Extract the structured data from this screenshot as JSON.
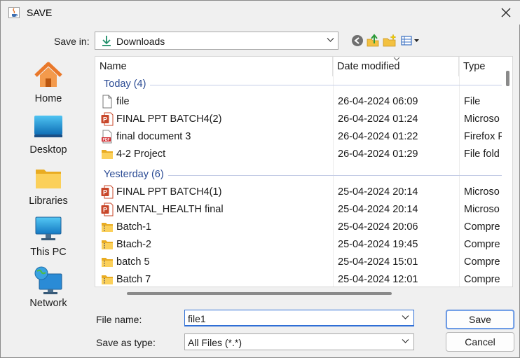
{
  "window": {
    "title": "SAVE"
  },
  "toolbar": {
    "save_in_label": "Save in:",
    "save_in_value": "Downloads"
  },
  "places": [
    {
      "label": "Home",
      "icon": "home-icon"
    },
    {
      "label": "Desktop",
      "icon": "desktop-icon"
    },
    {
      "label": "Libraries",
      "icon": "libraries-folder-icon"
    },
    {
      "label": "This PC",
      "icon": "computer-icon"
    },
    {
      "label": "Network",
      "icon": "network-icon"
    }
  ],
  "columns": {
    "name": "Name",
    "date": "Date modified",
    "type": "Type"
  },
  "groups": [
    {
      "label": "Today (4)",
      "files": [
        {
          "name": "file",
          "date": "26-04-2024 06:09",
          "type": "File",
          "icon": "blank-file-icon"
        },
        {
          "name": "FINAL PPT BATCH4(2)",
          "date": "26-04-2024 01:24",
          "type": "Microso",
          "icon": "powerpoint-icon"
        },
        {
          "name": "final document 3",
          "date": "26-04-2024 01:22",
          "type": "Firefox P",
          "icon": "pdf-icon"
        },
        {
          "name": "4-2 Project",
          "date": "26-04-2024 01:29",
          "type": "File fold",
          "icon": "folder-icon"
        }
      ]
    },
    {
      "label": "Yesterday (6)",
      "files": [
        {
          "name": "FINAL PPT BATCH4(1)",
          "date": "25-04-2024 20:14",
          "type": "Microso",
          "icon": "powerpoint-icon"
        },
        {
          "name": "MENTAL_HEALTH final",
          "date": "25-04-2024 20:14",
          "type": "Microso",
          "icon": "powerpoint-icon"
        },
        {
          "name": "Batch-1",
          "date": "25-04-2024 20:06",
          "type": "Compre",
          "icon": "zip-folder-icon"
        },
        {
          "name": "Btach-2",
          "date": "25-04-2024 19:45",
          "type": "Compre",
          "icon": "zip-folder-icon"
        },
        {
          "name": "batch 5",
          "date": "25-04-2024 15:01",
          "type": "Compre",
          "icon": "zip-folder-icon"
        },
        {
          "name": "Batch 7",
          "date": "25-04-2024 12:01",
          "type": "Compre",
          "icon": "zip-folder-icon"
        }
      ]
    }
  ],
  "form": {
    "file_name_label": "File name:",
    "file_name_value": "file1",
    "type_label": "Save as type:",
    "type_value": "All Files (*.*)"
  },
  "buttons": {
    "save": "Save",
    "cancel": "Cancel"
  },
  "colors": {
    "group_header": "#2b4b94",
    "accent": "#2f6fd6"
  }
}
